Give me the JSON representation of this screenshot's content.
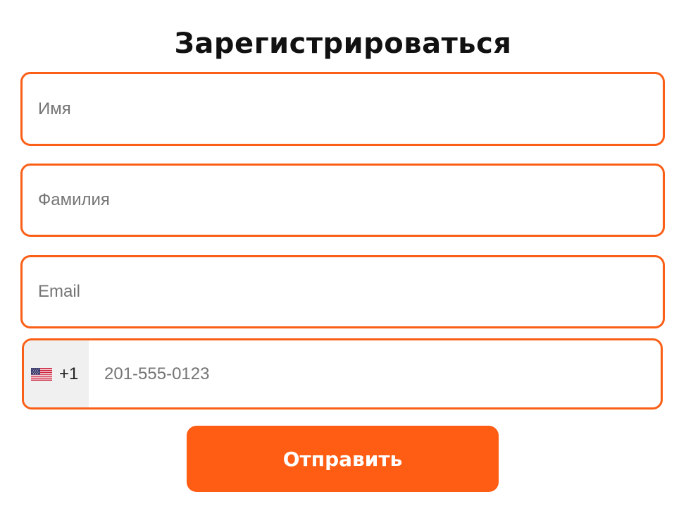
{
  "form": {
    "title": "Зарегистрироваться",
    "first_name": {
      "placeholder": "Имя",
      "value": ""
    },
    "last_name": {
      "placeholder": "Фамилия",
      "value": ""
    },
    "email": {
      "placeholder": "Email",
      "value": ""
    },
    "phone": {
      "country_flag_icon": "us-flag-icon",
      "dial_code": "+1",
      "placeholder": "201-555-0123",
      "value": ""
    },
    "submit_label": "Отправить"
  },
  "colors": {
    "accent": "#fa5f17",
    "button": "#ff5c14",
    "country_select_bg": "#f0f0f0",
    "placeholder": "#757575"
  }
}
